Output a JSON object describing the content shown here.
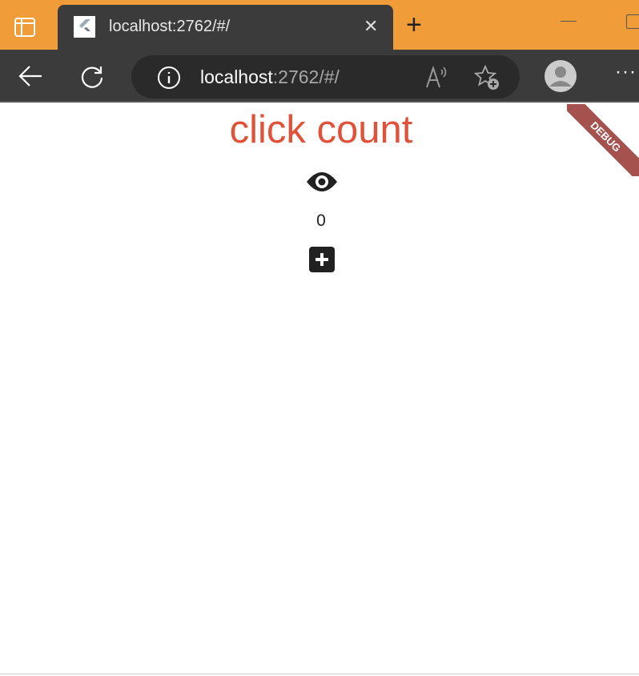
{
  "browser": {
    "tab_title": "localhost:2762/#/",
    "url_host": "localhost",
    "url_rest": ":2762/#/",
    "accent": "#f09c38"
  },
  "app": {
    "title": "click count",
    "count": "0",
    "debug_label": "DEBUG",
    "title_color": "#e0533a"
  }
}
